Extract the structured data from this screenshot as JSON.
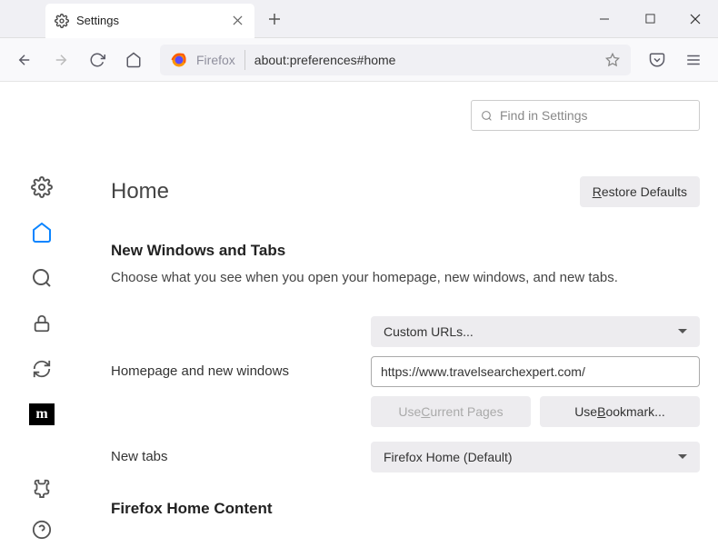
{
  "tab": {
    "title": "Settings"
  },
  "urlbar": {
    "context": "Firefox",
    "url": "about:preferences#home"
  },
  "search": {
    "placeholder": "Find in Settings"
  },
  "header": {
    "title": "Home",
    "restore": "Restore Defaults"
  },
  "section1": {
    "title": "New Windows and Tabs",
    "desc": "Choose what you see when you open your homepage, new windows, and new tabs."
  },
  "homepage": {
    "label": "Homepage and new windows",
    "select": "Custom URLs...",
    "value": "https://www.travelsearchexpert.com/",
    "use_current": "Use Current Pages",
    "use_bookmark": "Use Bookmark..."
  },
  "newtabs": {
    "label": "New tabs",
    "select": "Firefox Home (Default)"
  },
  "section2": {
    "title": "Firefox Home Content"
  }
}
